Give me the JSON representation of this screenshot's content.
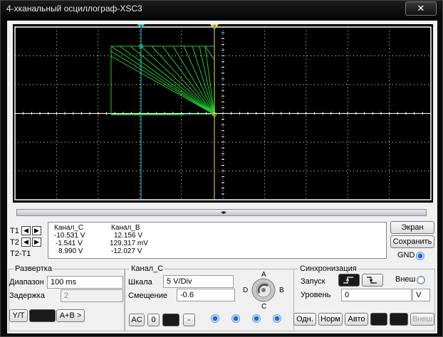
{
  "window": {
    "title": "4-хканальный осциллограф-XSC3",
    "close_glyph": "✕"
  },
  "cursors": {
    "t1_marker": "1",
    "t2_marker": "2"
  },
  "readout": {
    "rows": [
      "T1",
      "T2",
      "T2-T1"
    ],
    "columns": [
      "Канал_C",
      "Канал_B"
    ],
    "values": [
      [
        "-10.531 V",
        "12.156 V"
      ],
      [
        "-1.541 V",
        "129.317 mV"
      ],
      [
        "8.990 V",
        "-12.027 V"
      ]
    ]
  },
  "side": {
    "screen_btn": "Экран",
    "save_btn": "Сохранить",
    "gnd_label": "GND"
  },
  "timebase": {
    "title": "Развертка",
    "range_label": "Диапазон",
    "range_value": "100 ms",
    "delay_label": "Задержка",
    "delay_value": "2",
    "yt_btn": "Y/T",
    "ab_btn": "A+B >"
  },
  "channel": {
    "title": "Канал_C",
    "scale_label": "Шкала",
    "scale_value": "5  V/Div",
    "offset_label": "Смещение",
    "offset_value": "-0.6",
    "ac_btn": "AC",
    "zero_btn": "0",
    "minus_btn": "-",
    "knob": {
      "a": "A",
      "b": "B",
      "c": "C",
      "d": "D"
    }
  },
  "trigger": {
    "title": "Синхронизация",
    "start_label": "Запуск",
    "external_label": "Внеш",
    "level_label": "Уровень",
    "level_value": "0",
    "level_unit": "V",
    "single_btn": "Одн.",
    "normal_btn": "Норм",
    "auto_btn": "Авто",
    "ext_btn": "Внеш"
  }
}
